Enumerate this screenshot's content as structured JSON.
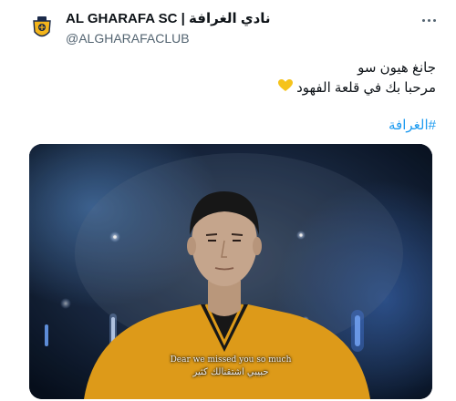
{
  "account": {
    "display_name": "AL GHARAFA SC | نادي الغرافة",
    "handle": "@ALGHARAFACLUB"
  },
  "tweet": {
    "line1": "جانغ هيون سو",
    "line2": "مرحبا بك في قلعة الفهود",
    "hashtag": "#الغرافة"
  },
  "media": {
    "caption_en": "Dear we missed you so much",
    "caption_ar": "حبيبي اشتقنالك كثير"
  },
  "colors": {
    "link": "#1d9bf0",
    "handle": "#536471",
    "jersey": "#f0a81c",
    "heart": "#f5c31b"
  },
  "icons": [
    "club-crest-icon",
    "more-options-icon",
    "yellow-heart-icon"
  ]
}
